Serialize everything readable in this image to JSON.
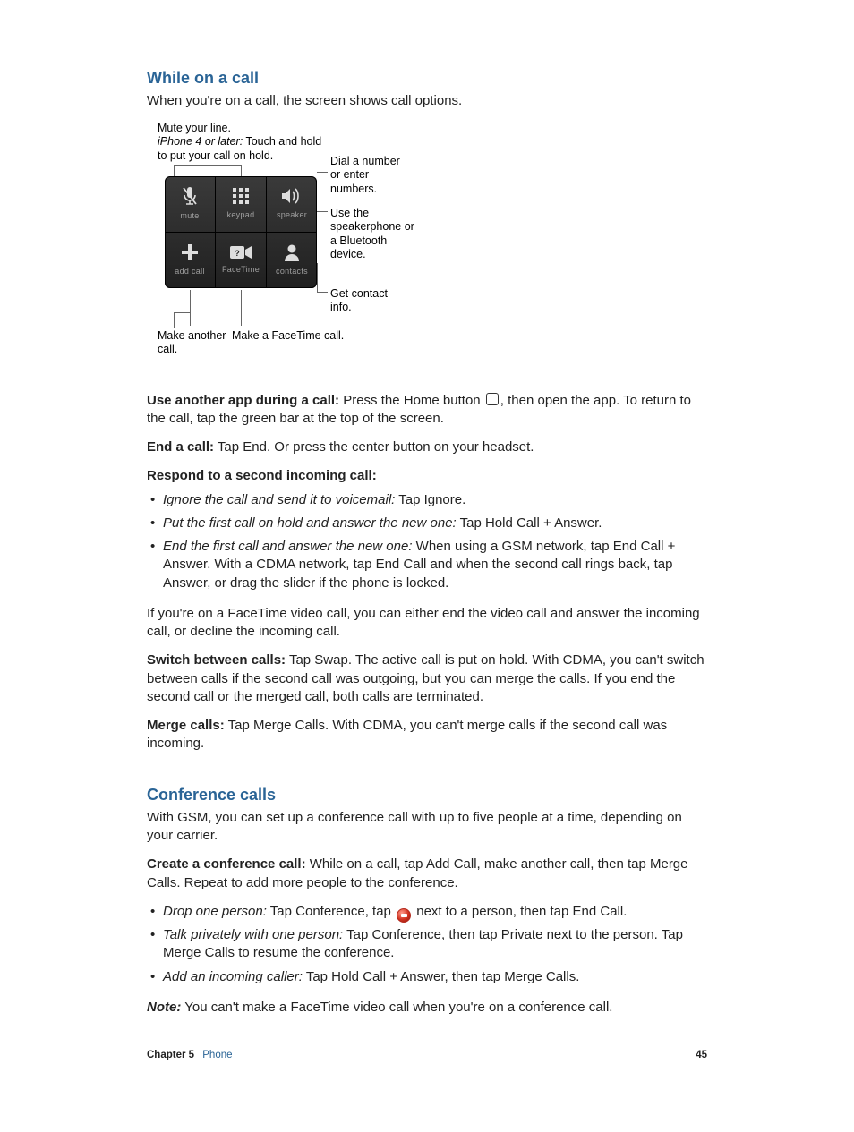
{
  "section1": {
    "title": "While on a call",
    "intro": "When you're on a call, the screen shows call options."
  },
  "figure": {
    "mute_line1": "Mute your line.",
    "mute_line2_label": "iPhone 4 or later:",
    "mute_line2_rest": " Touch and hold to put your call on hold.",
    "dial": "Dial a number or enter numbers.",
    "speaker": "Use the speakerphone or a Bluetooth device.",
    "contacts": "Get contact info.",
    "make_another": "Make another call.",
    "facetime": "Make a FaceTime call.",
    "buttons": {
      "mute": "mute",
      "keypad": "keypad",
      "speaker": "speaker",
      "addcall": "add call",
      "facetime": "FaceTime",
      "contacts": "contacts"
    }
  },
  "body": {
    "use_app_label": "Use another app during a call:",
    "use_app_pre": "  Press the Home button ",
    "use_app_post": ", then open the app. To return to the call, tap the green bar at the top of the screen.",
    "end_label": "End a call:",
    "end_text": "  Tap End. Or press the center button on your headset.",
    "respond_heading": "Respond to a second incoming call:",
    "bullets1": [
      {
        "lead": "Ignore the call and send it to voicemail:",
        "body": "  Tap Ignore."
      },
      {
        "lead": "Put the first call on hold and answer the new one:",
        "body": "  Tap Hold Call + Answer."
      },
      {
        "lead": "End the first call and answer the new one:",
        "body": "  When using a GSM network, tap End Call + Answer. With a CDMA network, tap End Call and when the second call rings back, tap Answer, or drag the slider if the phone is locked."
      }
    ],
    "facetime_para": "If you're on a FaceTime video call, you can either end the video call and answer the incoming call, or decline the incoming call.",
    "switch_label": "Switch between calls:",
    "switch_text": "  Tap Swap. The active call is put on hold. With CDMA, you can't switch between calls if the second call was outgoing, but you can merge the calls. If you end the second call or the merged call, both calls are terminated.",
    "merge_label": "Merge calls:",
    "merge_text": "  Tap Merge Calls. With CDMA, you can't merge calls if the second call was incoming."
  },
  "section2": {
    "title": "Conference calls",
    "intro": "With GSM, you can set up a conference call with up to five people at a time, depending on your carrier.",
    "create_label": "Create a conference call:",
    "create_text": "  While on a call, tap Add Call, make another call, then tap Merge Calls. Repeat to add more people to the conference.",
    "bullets2": [
      {
        "lead": "Drop one person:",
        "pre": "  Tap Conference, tap ",
        "post": " next to a person, then tap End Call."
      },
      {
        "lead": "Talk privately with one person:",
        "body": "  Tap Conference, then tap Private next to the person. Tap Merge Calls to resume the conference."
      },
      {
        "lead": "Add an incoming caller:",
        "body": "  Tap Hold Call + Answer, then tap Merge Calls."
      }
    ],
    "note_label": "Note:",
    "note_text": "  You can't make a FaceTime video call when you're on a conference call."
  },
  "footer": {
    "chapter": "Chapter  5",
    "chapter_label": "Phone",
    "page": "45"
  }
}
